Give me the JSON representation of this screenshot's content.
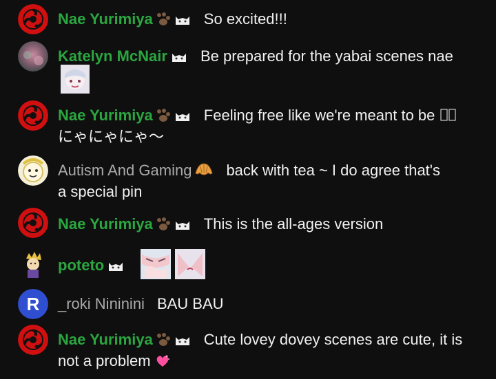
{
  "messages": [
    {
      "author": "Nae Yurimiya",
      "text": "So excited!!!"
    },
    {
      "author": "Katelyn McNair",
      "text": "Be prepared for the yabai scenes nae"
    },
    {
      "author": "Nae Yurimiya",
      "text": "Feeling free like we're meant to be",
      "text2": "にゃにゃにゃ〜"
    },
    {
      "author": "Autism And Gaming",
      "text": "back with tea ~ I do agree that's",
      "text2": "a special pin"
    },
    {
      "author": "Nae Yurimiya",
      "text": "This is the all-ages version"
    },
    {
      "author": "poteto",
      "text": ""
    },
    {
      "author": "_roki Nininini",
      "text": "BAU BAU"
    },
    {
      "author": "Nae Yurimiya",
      "text": "Cute lovey dovey scenes are cute, it is",
      "text2": "not a problem"
    }
  ],
  "colors": {
    "background": "#0f0f0f",
    "member_name": "#2ba640",
    "plain_name": "#aaaaaa",
    "message_text": "#f1f1f1"
  },
  "icons": {
    "member_badge": "cat-face-icon",
    "paw_badge": "paw-icon",
    "croissant_badge": "croissant-icon",
    "heart_emoji": "heart-icon"
  }
}
